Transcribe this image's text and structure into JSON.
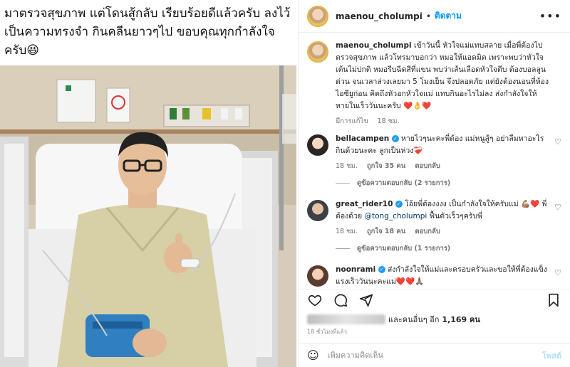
{
  "left": {
    "headline": "มาตรวจสุขภาพ แต่โดนสู้กลับ เรียบร้อยดีแล้วครับ ลงไว้เป็นความทรงจำ กินคลีนยาวๆไป ขอบคุณทุกกำลังใจครับ😆"
  },
  "header": {
    "username": "maenou_cholumpi",
    "dot": "•",
    "follow_label": "ติดตาม",
    "more_icon": "more-options-icon"
  },
  "caption": {
    "username": "maenou_cholumpi",
    "text": "เข้าวันนี้ หัวใจแม่แทบสลาย เมื่อพี่ต้องไปตรวจสุขภาพ แล้วโทรมาบอกว่า หมอให้แอดมิต เพราะพบว่าหัวใจเต้นไม่ปกติ หมอรีบฉีดสีที่แขน พบว่าเส้นเลือดหัวใจตีบ ต้องบอลลูนด่วน จนเวลาล่วงเลยมา 5 โมงเย็น จึงปลอดภัย แต่ยังต้องนอนที่ห้อง ไอซียูก่อน คิดถึงหัวอกหัวใจแม่ แทบกินอะไรไม่ลง ส่งกำลังใจให้หายในเร็ววันนะครับ ",
    "emojis": "❤️👌❤️",
    "edited": "มีการแก้ไข",
    "time": "18 ชม."
  },
  "comments": [
    {
      "username": "bellacampen",
      "text": "หายไวๆนะคะพี่ต้อง แม่หนูสู้ๆ อย่าลืมหาอะไรกินด้วยนะคะ ลูกเป็นห่วง",
      "emoji": "❤️‍🩹",
      "time": "18 ชม.",
      "likes": "ถูกใจ 35 คน",
      "reply": "ตอบกลับ",
      "view_replies": "ดูข้อความตอบกลับ (2 รายการ)"
    },
    {
      "username": "great_rider10",
      "text_before": "โอ้ยพี่ต้องงงง เป็นกำลังใจให้ครับแม่ ",
      "emoji": "💪🏽❤️",
      "text_after": " พี่ต้องด้วย ",
      "mention": "@tong_cholumpi",
      "text_end": " ฟื้นตัวเร็วๆครับพี่",
      "time": "18 ชม.",
      "likes": "ถูกใจ 18 คน",
      "reply": "ตอบกลับ",
      "view_replies": "ดูข้อความตอบกลับ (1 รายการ)"
    },
    {
      "username": "noonrami",
      "text": "ส่งกำลังใจให้แม่และครอบครัวและขอให้พี่ต้องแข็งแรงเร็ววันนะคะแม่",
      "emoji": "❤️❤️🙏🏽"
    }
  ],
  "likes_line": {
    "and_others": "และคนอื่นๆ อีก",
    "count": "1,169 คน"
  },
  "timestamp": "18 ชั่วโมงที่แล้ว",
  "add_comment": {
    "placeholder": "เพิ่มความคิดเห็น",
    "post_label": "โพสต์",
    "emoji_icon": "☺"
  },
  "icons": {
    "like": "heart-icon",
    "comment": "comment-icon",
    "share": "share-icon",
    "save": "bookmark-icon"
  },
  "colors": {
    "accent": "#0095f6",
    "heart": "#ed4956",
    "verified": "#1d9bf0"
  }
}
